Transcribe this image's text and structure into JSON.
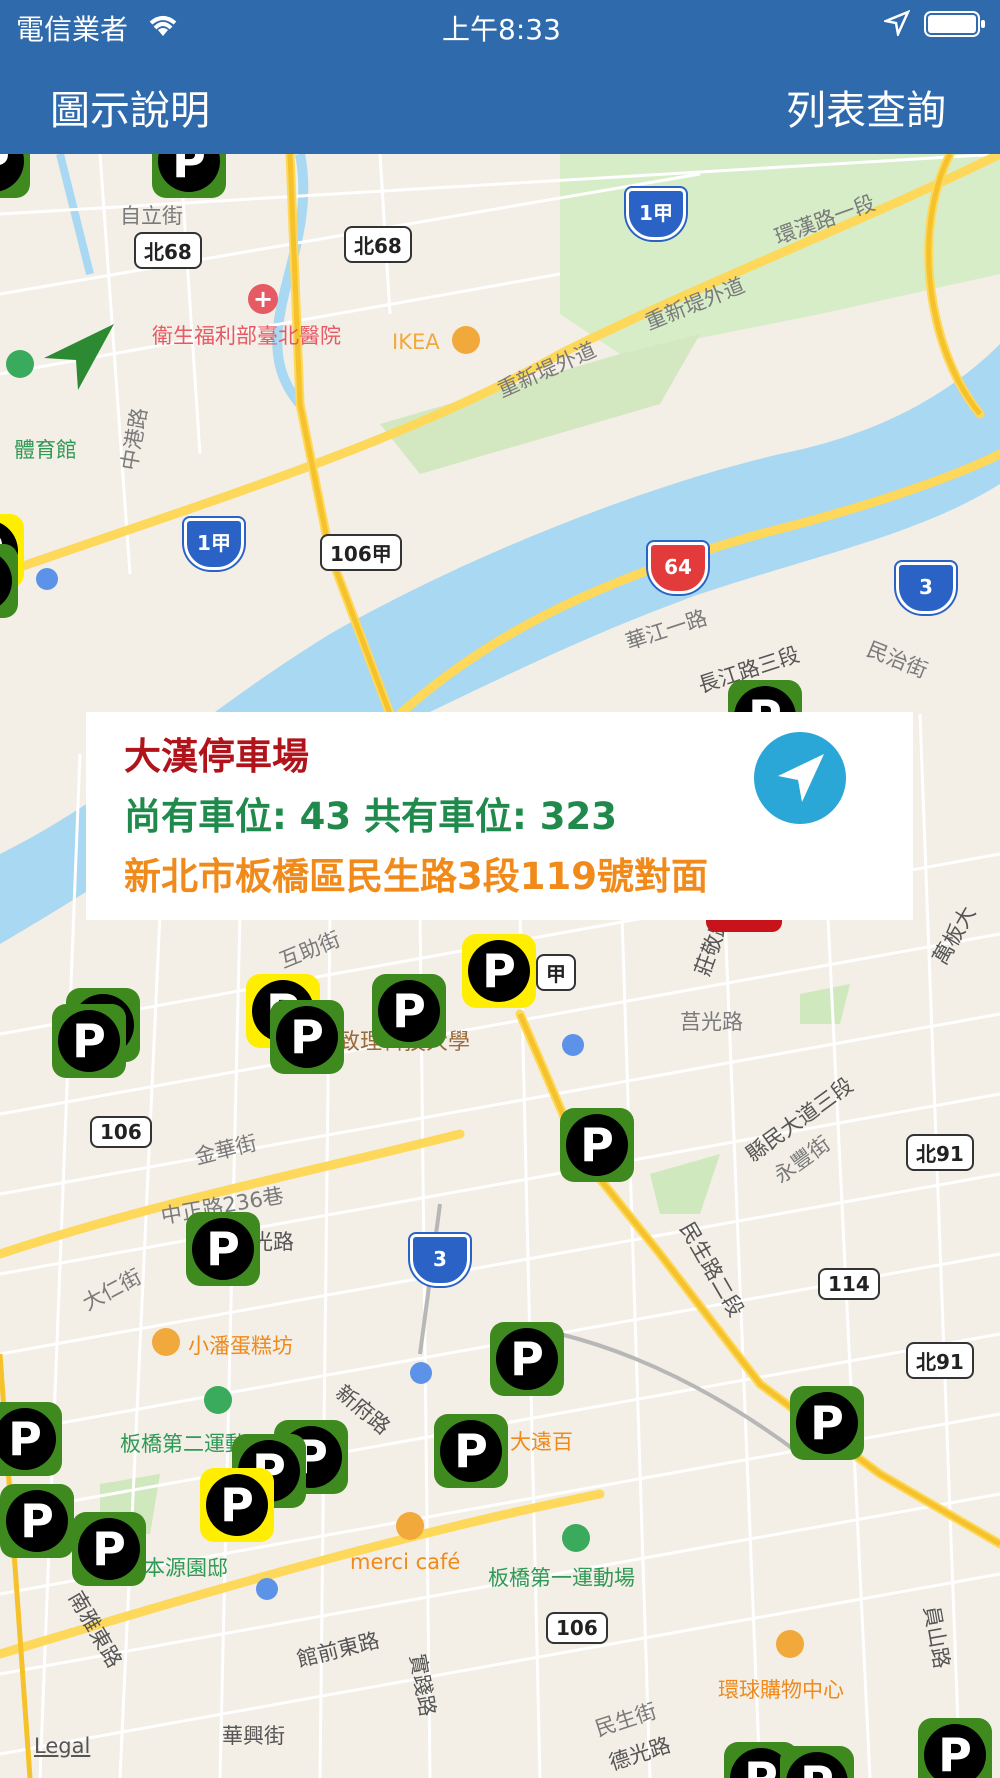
{
  "status_bar": {
    "carrier": "電信業者",
    "time": "上午8:33",
    "icons": [
      "wifi-icon",
      "location-arrow-icon",
      "battery-icon"
    ]
  },
  "nav_bar": {
    "left_button": "圖示說明",
    "right_button": "列表查詢",
    "color": "#2f6aad"
  },
  "popup": {
    "title": "大漢停車場",
    "availability": "尚有車位: 43  共有車位: 323",
    "address": "新北市板橋區民生路3段119號對面",
    "title_color": "#b0141a",
    "availability_color": "#1f8a4c",
    "address_color": "#f08a1a",
    "nav_icon": "navigate-arrow-icon"
  },
  "map": {
    "labels": {
      "l1": "自立街",
      "l2": "衛生福利部臺北醫院",
      "l3": "IKEA",
      "l4": "重新堤外道",
      "l5": "重新堤外道",
      "l6": "環漢路一段",
      "l7": "中港路",
      "l8": "華江一路",
      "l9": "長江路三段",
      "l10": "民治街",
      "l11": "互助街",
      "l12": "莊敬路",
      "l13": "莒光路",
      "l14": "萬板大",
      "l15": "金華街",
      "l16": "中正路236巷",
      "l17": "致理科技大學",
      "l18": "縣民大道三段",
      "l19": "永豐街",
      "l20": "民生路二段",
      "l21": "大仁街",
      "l22": "小潘蛋糕坊",
      "l23": "新府路",
      "l24": "大遠百",
      "l25": "板橋第二運動",
      "l26": "本源園邸",
      "l27": "merci café",
      "l28": "板橋第一運動場",
      "l29": "館前東路",
      "l30": "實踐路",
      "l31": "南雅東路",
      "l32": "環球購物中心",
      "l33": "華興街",
      "l34": "民生街",
      "l35": "德光路",
      "l36": "員山路",
      "l37": "Legal",
      "l38": "體育館",
      "l39": "光路"
    },
    "shields": {
      "s1": "北68",
      "s2": "北68",
      "s3": "106甲",
      "s4": "106",
      "s5": "北91",
      "s6": "114",
      "s7": "北91",
      "s8": "106",
      "s9": "甲"
    },
    "highways": {
      "h1": "1甲",
      "h2": "1甲",
      "h3": "64",
      "h4": "3",
      "h5": "3"
    },
    "parking_marker_label": "P"
  }
}
